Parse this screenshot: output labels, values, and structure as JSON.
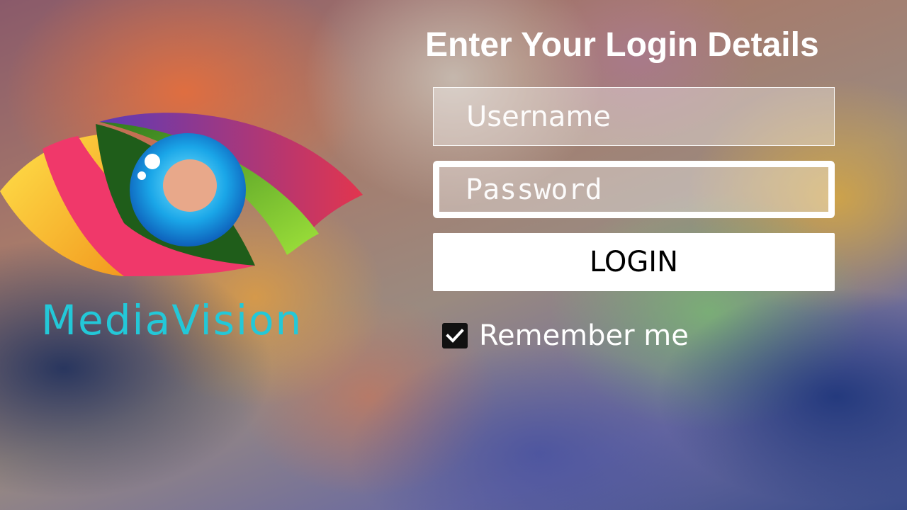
{
  "brand": {
    "name": "MediaVision",
    "color": "#23c8d8"
  },
  "login_form": {
    "title": "Enter Your Login Details",
    "username_placeholder": "Username",
    "password_placeholder": "Password",
    "login_label": "LOGIN",
    "remember_label": "Remember me",
    "remember_checked": true
  },
  "icons": {
    "logo": "eye-logo-icon",
    "checkbox": "checkmark-icon"
  }
}
